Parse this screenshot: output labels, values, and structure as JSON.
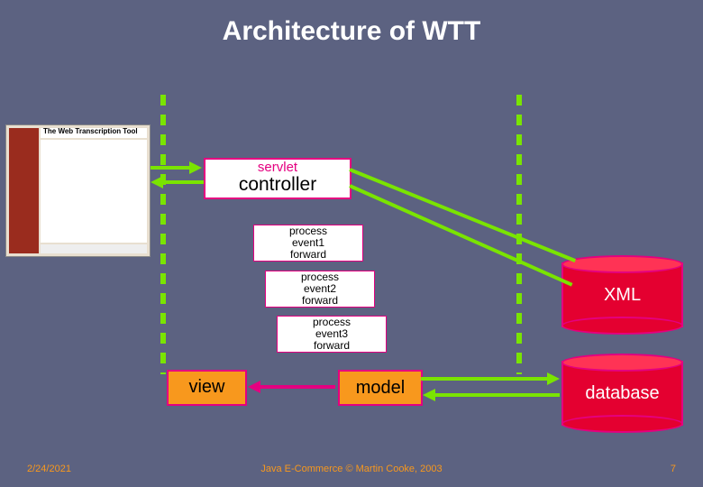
{
  "title": "Architecture of WTT",
  "screenshot": {
    "banner": "The Web Transcription Tool"
  },
  "controller": {
    "servlet": "servlet",
    "label": "controller"
  },
  "events": [
    {
      "process": "process",
      "event": "event1",
      "forward": "forward"
    },
    {
      "process": "process",
      "event": "event2",
      "forward": "forward"
    },
    {
      "process": "process",
      "event": "event3",
      "forward": "forward"
    }
  ],
  "view": {
    "label": "view"
  },
  "model": {
    "label": "model"
  },
  "cylinders": {
    "xml": "XML",
    "database": "database"
  },
  "footer": {
    "date": "2/24/2021",
    "credit": "Java E-Commerce © Martin Cooke, 2003",
    "page": "7"
  }
}
